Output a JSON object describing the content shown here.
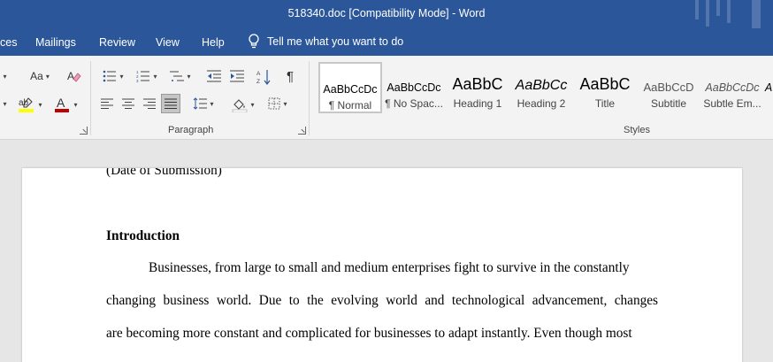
{
  "window": {
    "title": "518340.doc [Compatibility Mode]  -  Word"
  },
  "menu": {
    "tabs": [
      "ces",
      "Mailings",
      "Review",
      "View",
      "Help"
    ],
    "tell_me": "Tell me what you want to do"
  },
  "ribbon": {
    "font_group": {
      "change_case": "Aa",
      "highlight_label": "ab",
      "font_color_label": "A",
      "font_color": "#c00000",
      "highlight_color": "#ffff00"
    },
    "paragraph_group": {
      "label": "Paragraph"
    },
    "styles_group": {
      "label": "Styles",
      "items": [
        {
          "sample": "AaBbCcDc",
          "name": "¶ Normal",
          "selected": true
        },
        {
          "sample": "AaBbCcDc",
          "name": "¶ No Spac..."
        },
        {
          "sample": "AaBbC",
          "name": "Heading 1"
        },
        {
          "sample": "AaBbCc",
          "name": "Heading 2"
        },
        {
          "sample": "AaBbC",
          "name": "Title"
        },
        {
          "sample": "AaBbCcD",
          "name": "Subtitle"
        },
        {
          "sample": "AaBbCcDc",
          "name": "Subtle Em..."
        },
        {
          "sample": "A",
          "name": ""
        }
      ]
    }
  },
  "document": {
    "line_date": "(Date of Submission)",
    "heading": "Introduction",
    "line1": "Businesses, from large to small and medium enterprises fight to survive in the constantly",
    "line2": "changing business world.  Due to the evolving world and technological advancement, changes",
    "line3": "are becoming more constant and complicated for businesses to adapt instantly. Even though most"
  }
}
